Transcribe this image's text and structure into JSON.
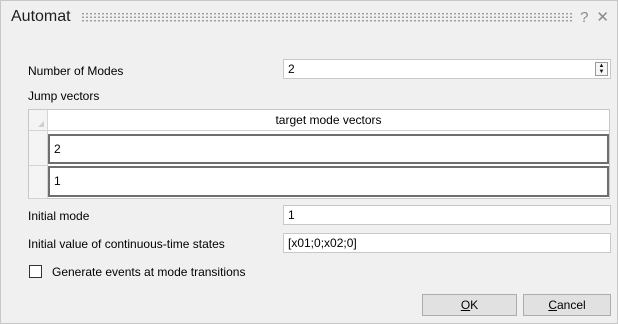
{
  "window": {
    "title": "Automat",
    "help_glyph": "?",
    "close_glyph": "✕"
  },
  "number_of_modes": {
    "label": "Number of Modes",
    "value": "2"
  },
  "jump_vectors": {
    "label": "Jump vectors",
    "column_header": "target mode vectors",
    "rows": [
      "2",
      "1"
    ]
  },
  "initial_mode": {
    "label": "Initial mode",
    "value": "1"
  },
  "initial_states": {
    "label": "Initial value of continuous-time states",
    "value": "[x01;0;x02;0]"
  },
  "generate_events": {
    "label": "Generate events at mode transitions",
    "checked": false
  },
  "buttons": {
    "ok_mnemonic": "O",
    "ok_rest": "K",
    "cancel_mnemonic": "C",
    "cancel_rest": "ancel"
  },
  "icons": {
    "stepper_up": "▲",
    "stepper_down": "▼"
  }
}
